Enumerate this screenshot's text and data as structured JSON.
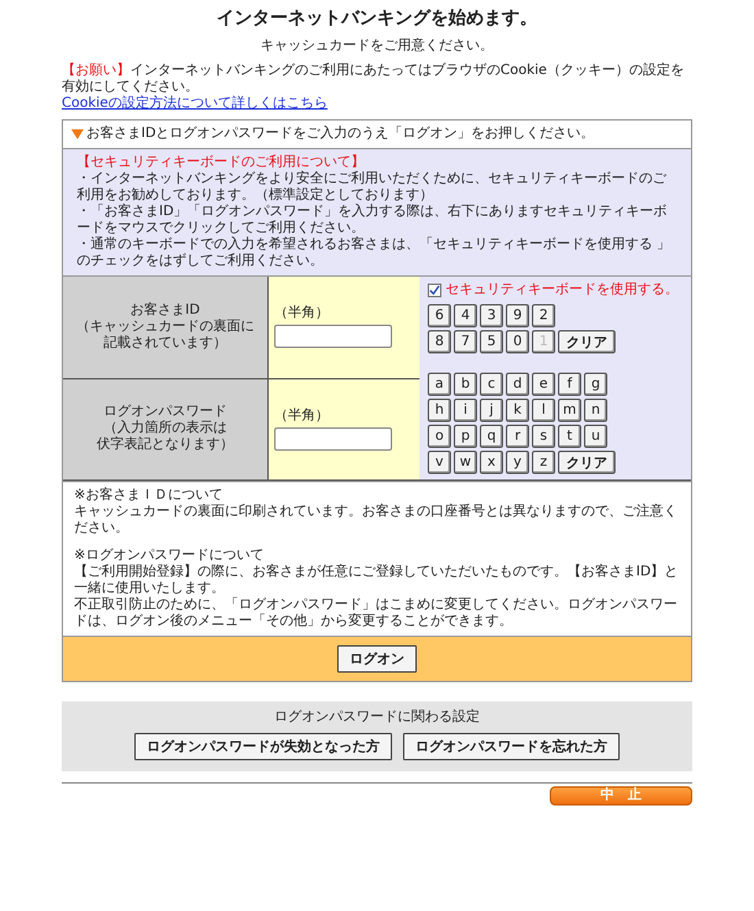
{
  "title": "インターネットバンキングを始めます。",
  "subtitle": "キャッシュカードをご用意ください。",
  "notice": {
    "label": "【お願い】",
    "text": "インターネットバンキングのご利用にあたってはブラウザのCookie（クッキー）の設定を有効にしてください。"
  },
  "cookie_link": "Cookieの設定方法について詳しくはこちら",
  "instruction": "お客さまIDとログオンパスワードをご入力のうえ「ログオン」をお押しください。",
  "security_info": {
    "heading": "【セキュリティキーボードのご利用について】",
    "lines": [
      "・インターネットバンキングをより安全にご利用いただくために、セキュリティキーボードのご利用をお勧めしております。（標準設定としております）",
      "・「お客さまID」「ログオンパスワード」を入力する際は、右下にありますセキュリティキーボードをマウスでクリックしてご利用ください。",
      "・通常のキーボードでの入力を希望されるお客さまは、「セキュリティキーボードを使用する 」のチェックをはずしてご利用ください。"
    ]
  },
  "fields": [
    {
      "label": [
        "お客さまID",
        "（キャッシュカードの裏面に",
        "記載されています）"
      ],
      "hint": "（半角）"
    },
    {
      "label": [
        "ログオンパスワード",
        "（入力箇所の表示は",
        "伏字表記となります）"
      ],
      "hint": "（半角）"
    }
  ],
  "security_keyboard": {
    "checkbox": {
      "label": "セキュリティキーボードを使用する。",
      "checked": true
    },
    "numeric_rows": [
      [
        {
          "label": "6",
          "kind": "char",
          "disabled": false
        },
        {
          "label": "4",
          "kind": "char",
          "disabled": false
        },
        {
          "label": "3",
          "kind": "char",
          "disabled": false
        },
        {
          "label": "9",
          "kind": "char",
          "disabled": false
        },
        {
          "label": "2",
          "kind": "char",
          "disabled": false
        }
      ],
      [
        {
          "label": "8",
          "kind": "char",
          "disabled": false
        },
        {
          "label": "7",
          "kind": "char",
          "disabled": false
        },
        {
          "label": "5",
          "kind": "char",
          "disabled": false
        },
        {
          "label": "0",
          "kind": "char",
          "disabled": false
        },
        {
          "label": "1",
          "kind": "char",
          "disabled": true
        },
        {
          "label": "クリア",
          "kind": "clear",
          "disabled": false
        }
      ]
    ],
    "alpha_rows": [
      [
        {
          "label": "a",
          "kind": "char",
          "disabled": false
        },
        {
          "label": "b",
          "kind": "char",
          "disabled": false
        },
        {
          "label": "c",
          "kind": "char",
          "disabled": false
        },
        {
          "label": "d",
          "kind": "char",
          "disabled": false
        },
        {
          "label": "e",
          "kind": "char",
          "disabled": false
        },
        {
          "label": "f",
          "kind": "char",
          "disabled": false
        },
        {
          "label": "g",
          "kind": "char",
          "disabled": false
        }
      ],
      [
        {
          "label": "h",
          "kind": "char",
          "disabled": false
        },
        {
          "label": "i",
          "kind": "char",
          "disabled": false
        },
        {
          "label": "j",
          "kind": "char",
          "disabled": false
        },
        {
          "label": "k",
          "kind": "char",
          "disabled": false
        },
        {
          "label": "l",
          "kind": "char",
          "disabled": false
        },
        {
          "label": "m",
          "kind": "char",
          "disabled": false
        },
        {
          "label": "n",
          "kind": "char",
          "disabled": false
        }
      ],
      [
        {
          "label": "o",
          "kind": "char",
          "disabled": false
        },
        {
          "label": "p",
          "kind": "char",
          "disabled": false
        },
        {
          "label": "q",
          "kind": "char",
          "disabled": false
        },
        {
          "label": "r",
          "kind": "char",
          "disabled": false
        },
        {
          "label": "s",
          "kind": "char",
          "disabled": false
        },
        {
          "label": "t",
          "kind": "char",
          "disabled": false
        },
        {
          "label": "u",
          "kind": "char",
          "disabled": false
        }
      ],
      [
        {
          "label": "v",
          "kind": "char",
          "disabled": false
        },
        {
          "label": "w",
          "kind": "char",
          "disabled": false
        },
        {
          "label": "x",
          "kind": "char",
          "disabled": false
        },
        {
          "label": "y",
          "kind": "char",
          "disabled": false
        },
        {
          "label": "z",
          "kind": "char",
          "disabled": false
        },
        {
          "label": "クリア",
          "kind": "clear",
          "disabled": false
        }
      ]
    ]
  },
  "notes": [
    {
      "heading": "※お客さまＩＤについて",
      "lines": [
        "キャッシュカードの裏面に印刷されています。お客さまの口座番号とは異なりますので、ご注意ください。"
      ]
    },
    {
      "heading": "※ログオンパスワードについて",
      "lines": [
        "【ご利用開始登録】の際に、お客さまが任意にご登録していただいたものです。【お客さまID】と一緒に使用いたします。",
        "不正取引防止のために、「ログオンパスワード」はこまめに変更してください。ログオンパスワードは、ログオン後のメニュー「その他」から変更することができます。"
      ]
    }
  ],
  "logon_button": "ログオン",
  "password_settings": {
    "title": "ログオンパスワードに関わる設定",
    "buttons": [
      "ログオンパスワードが失効となった方",
      "ログオンパスワードを忘れた方"
    ]
  },
  "cancel_button": "中　止"
}
